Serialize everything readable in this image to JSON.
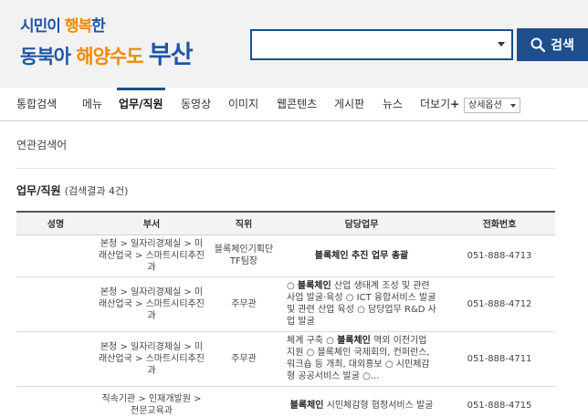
{
  "logo": {
    "line1_a": "시민이 ",
    "line1_b": "행복",
    "line1_c": "한",
    "line2_a": "동북아 ",
    "line2_b": "해양수도 ",
    "line2_c": "부산"
  },
  "search": {
    "value": "",
    "button_label": "검색"
  },
  "tabs": [
    {
      "label": "통합검색"
    },
    {
      "label": "메뉴"
    },
    {
      "label": "업무/직원"
    },
    {
      "label": "동영상"
    },
    {
      "label": "이미지"
    },
    {
      "label": "웹콘텐츠"
    },
    {
      "label": "게시판"
    },
    {
      "label": "뉴스"
    },
    {
      "label": "더보기",
      "suffix": "+"
    }
  ],
  "detail_option": "상세옵션",
  "related_label": "연관검색어",
  "section": {
    "title": "업무/직원",
    "count": "(검색결과 4건)"
  },
  "table": {
    "headers": [
      "성명",
      "부서",
      "직위",
      "담당업무",
      "전화번호"
    ],
    "rows": [
      {
        "name": "",
        "dept": "본청 > 일자리경제실 > 미래산업국 > 스마트시티추진과",
        "position": "블록체인기획단TF팀장",
        "duty_hl": "블록체인",
        "duty_rest": " 추진 업무 총괄",
        "phone": "051-888-4713"
      },
      {
        "name": "",
        "dept": "본청 > 일자리경제실 > 미래산업국 > 스마트시티추진과",
        "position": "주무관",
        "duty_pre": "○ ",
        "duty_hl": "블록체인",
        "duty_rest": " 산업 생태계 조성 및 관련 사업 발굴·육성 ○ ICT 융합서비스 발굴 및 관련 산업 육성 ○ 담당업무 R&D 사업 발굴",
        "phone": "051-888-4712"
      },
      {
        "name": "",
        "dept": "본청 > 일자리경제실 > 미래산업국 > 스마트시티추진과",
        "position": "주무관",
        "duty_pre": "체계 구축 ○ ",
        "duty_hl": "블록체인",
        "duty_rest": " 역외 이전기업 지원 ○ 블록체인 국제회의, 컨퍼런스, 워크숍 등 개최, 대외홍보 ○ 시민체감형 공공서비스 발굴 ○...",
        "phone": "051-888-4711"
      },
      {
        "name": "",
        "dept": "직속기관 > 인재개발원 > 전문교육과",
        "position": "",
        "duty_hl": "블록체인",
        "duty_rest": " 시민체감형 협정서비스 발굴",
        "phone": "051-888-4715"
      }
    ]
  },
  "colors": {
    "primary": "#1e4e8c",
    "logo_blue": "#1f55a8",
    "logo_orange": "#f08a00",
    "header_bg": "#f2f2f2"
  }
}
